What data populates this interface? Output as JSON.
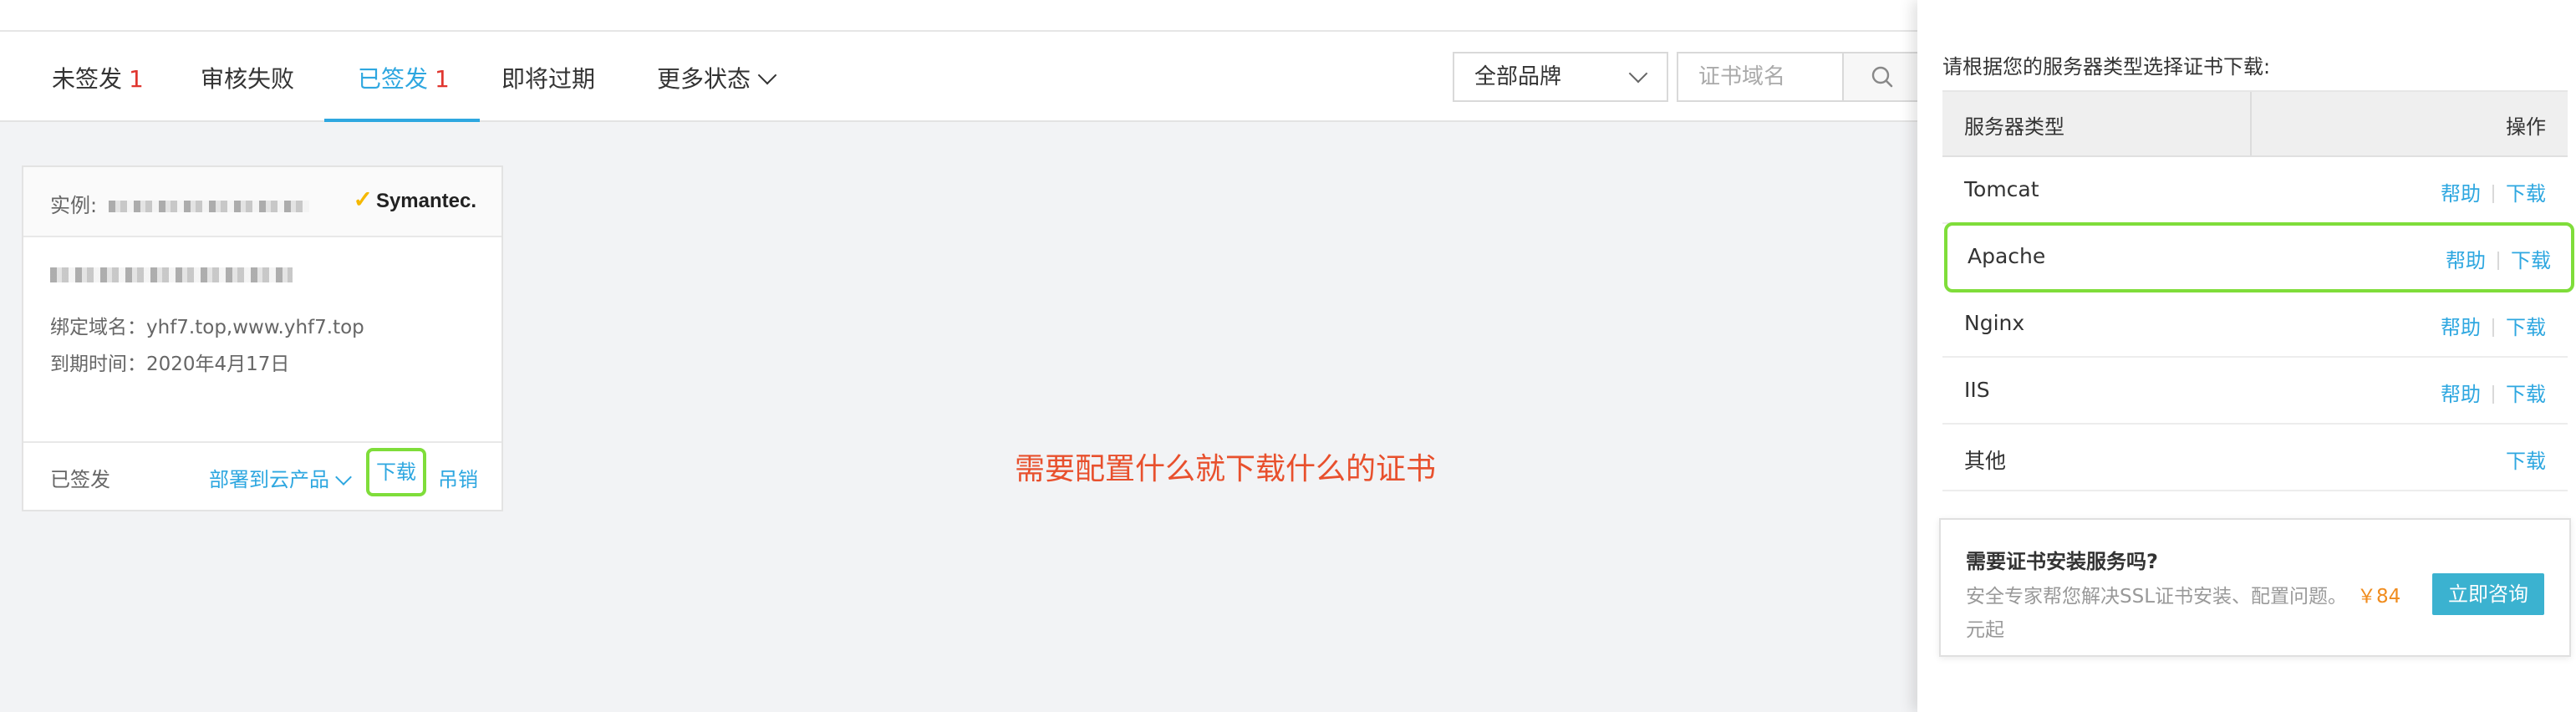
{
  "tabs": [
    {
      "label": "未签发",
      "count": "1"
    },
    {
      "label": "审核失败",
      "count": ""
    },
    {
      "label": "已签发",
      "count": "1"
    },
    {
      "label": "即将过期",
      "count": ""
    },
    {
      "label": "更多状态",
      "count": ""
    }
  ],
  "filters": {
    "brand_selected": "全部品牌",
    "domain_placeholder": "证书域名"
  },
  "card": {
    "instance_label": "实例:",
    "brand_logo": "Symantec.",
    "bound_domain": "绑定域名：yhf7.top,www.yhf7.top",
    "expire": "到期时间：2020年4月17日",
    "status": "已签发",
    "deploy": "部署到云产品",
    "download": "下载",
    "revoke": "吊销"
  },
  "annotation": "需要配置什么就下载什么的证书",
  "drawer": {
    "title": "请根据您的服务器类型选择证书下载:",
    "col_type": "服务器类型",
    "col_op": "操作",
    "help_label": "帮助",
    "download_label": "下载",
    "rows": [
      {
        "name": "Tomcat"
      },
      {
        "name": "Apache"
      },
      {
        "name": "Nginx"
      },
      {
        "name": "IIS"
      },
      {
        "name": "其他"
      }
    ],
    "promo": {
      "title": "需要证书安装服务吗?",
      "desc": "安全专家帮您解决SSL证书安装、配置问题。",
      "price": "￥84",
      "suffix": "元起",
      "button": "立即咨询"
    }
  },
  "colors": {
    "accent": "#2ea7e0",
    "count_red": "#e0362f",
    "highlight_green": "#7fdd3a",
    "annotation": "#e8502d",
    "price": "#f08c1e",
    "button": "#3bb2d0"
  }
}
